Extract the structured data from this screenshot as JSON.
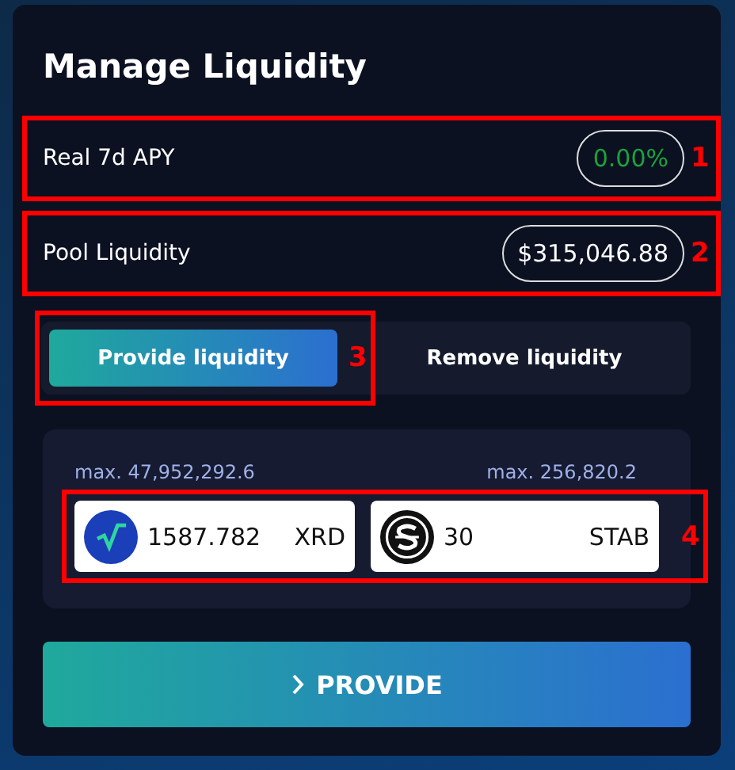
{
  "title": "Manage Liquidity",
  "stats": [
    {
      "label": "Real 7d APY",
      "value": "0.00%",
      "kind": "apy",
      "annotation": "1"
    },
    {
      "label": "Pool Liquidity",
      "value": "$315,046.88",
      "kind": "plain",
      "annotation": "2"
    }
  ],
  "tabs": [
    {
      "label": "Provide liquidity",
      "selected": true,
      "annotation": "3"
    },
    {
      "label": "Remove liquidity",
      "selected": false
    }
  ],
  "inputs": {
    "annotation": "4",
    "tokens": [
      {
        "max": "max. 47,952,292.6",
        "value": "1587.782",
        "symbol": "XRD",
        "kind": "xrd"
      },
      {
        "max": "max. 256,820.2",
        "value": "30",
        "symbol": "STAB",
        "kind": "stab"
      }
    ]
  },
  "button": {
    "label": "PROVIDE"
  }
}
